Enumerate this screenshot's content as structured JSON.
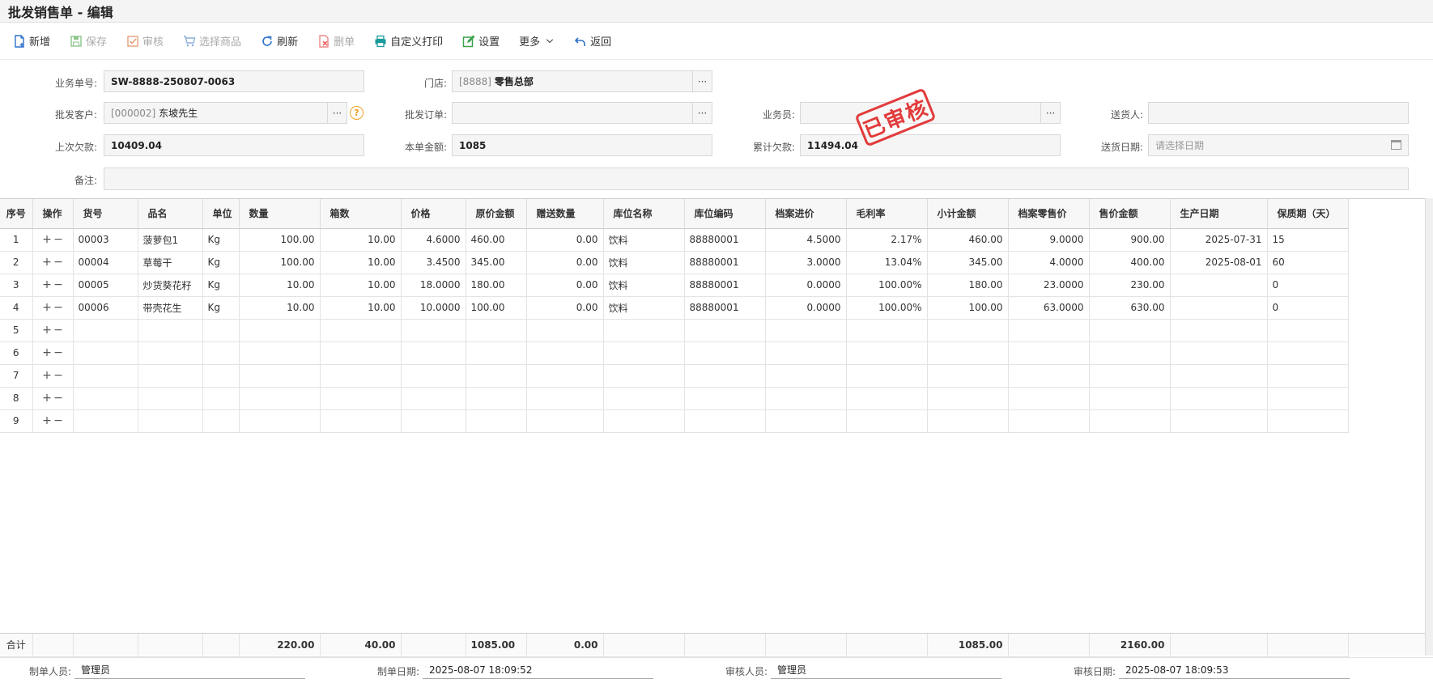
{
  "window": {
    "title": "批发销售单 - 编辑"
  },
  "toolbar": {
    "new": "新增",
    "save": "保存",
    "audit": "审核",
    "select_goods": "选择商品",
    "refresh": "刷新",
    "delete": "删单",
    "custom_print": "自定义打印",
    "settings": "设置",
    "more": "更多",
    "back": "返回"
  },
  "form": {
    "doc_no_label": "业务单号:",
    "doc_no": "SW-8888-250807-0063",
    "store_label": "门店:",
    "store_code": "[8888]",
    "store_name": "零售总部",
    "customer_label": "批发客户:",
    "customer_code": "[000002]",
    "customer_name": "东坡先生",
    "order_label": "批发订单:",
    "order": "",
    "salesman_label": "业务员:",
    "salesman": "",
    "deliverer_label": "送货人:",
    "deliverer": "",
    "last_debt_label": "上次欠款:",
    "last_debt": "10409.04",
    "amount_label": "本单金额:",
    "amount": "1085",
    "total_debt_label": "累计欠款:",
    "total_debt": "11494.04",
    "delivery_date_label": "送货日期:",
    "delivery_date_placeholder": "请选择日期",
    "remark_label": "备注:",
    "remark": "",
    "stamp": "已审核"
  },
  "grid": {
    "columns": [
      "序号",
      "操作",
      "货号",
      "品名",
      "单位",
      "数量",
      "箱数",
      "价格",
      "原价金额",
      "赠送数量",
      "库位名称",
      "库位编码",
      "档案进价",
      "毛利率",
      "小计金额",
      "档案零售价",
      "售价金额",
      "生产日期",
      "保质期（天）"
    ],
    "rows": [
      {
        "no": "1",
        "code": "00003",
        "name": "菠萝包1",
        "unit": "Kg",
        "qty": "100.00",
        "boxes": "10.00",
        "price": "4.6000",
        "orig_amount": "460.00",
        "gift_qty": "0.00",
        "loc_name": "饮料",
        "loc_code": "88880001",
        "cost": "4.5000",
        "margin": "2.17%",
        "subtotal": "460.00",
        "retail": "9.0000",
        "sale_amount": "900.00",
        "prod_date": "2025-07-31",
        "shelf": "15"
      },
      {
        "no": "2",
        "code": "00004",
        "name": "草莓干",
        "unit": "Kg",
        "qty": "100.00",
        "boxes": "10.00",
        "price": "3.4500",
        "orig_amount": "345.00",
        "gift_qty": "0.00",
        "loc_name": "饮料",
        "loc_code": "88880001",
        "cost": "3.0000",
        "margin": "13.04%",
        "subtotal": "345.00",
        "retail": "4.0000",
        "sale_amount": "400.00",
        "prod_date": "2025-08-01",
        "shelf": "60"
      },
      {
        "no": "3",
        "code": "00005",
        "name": "炒货葵花籽",
        "unit": "Kg",
        "qty": "10.00",
        "boxes": "10.00",
        "price": "18.0000",
        "orig_amount": "180.00",
        "gift_qty": "0.00",
        "loc_name": "饮料",
        "loc_code": "88880001",
        "cost": "0.0000",
        "margin": "100.00%",
        "subtotal": "180.00",
        "retail": "23.0000",
        "sale_amount": "230.00",
        "prod_date": "",
        "shelf": "0"
      },
      {
        "no": "4",
        "code": "00006",
        "name": "带壳花生",
        "unit": "Kg",
        "qty": "10.00",
        "boxes": "10.00",
        "price": "10.0000",
        "orig_amount": "100.00",
        "gift_qty": "0.00",
        "loc_name": "饮料",
        "loc_code": "88880001",
        "cost": "0.0000",
        "margin": "100.00%",
        "subtotal": "100.00",
        "retail": "63.0000",
        "sale_amount": "630.00",
        "prod_date": "",
        "shelf": "0"
      },
      {
        "no": "5"
      },
      {
        "no": "6"
      },
      {
        "no": "7"
      },
      {
        "no": "8"
      },
      {
        "no": "9"
      }
    ],
    "op_plus": "+",
    "op_minus": "−",
    "totals": {
      "label": "合计",
      "qty": "220.00",
      "boxes": "40.00",
      "orig_amount": "1085.00",
      "gift_qty": "0.00",
      "subtotal": "1085.00",
      "sale_amount": "2160.00"
    }
  },
  "footer": {
    "creator_label": "制单人员:",
    "creator": "管理员",
    "create_date_label": "制单日期:",
    "create_date": "2025-08-07 18:09:52",
    "auditor_label": "审核人员:",
    "auditor": "管理员",
    "audit_date_label": "审核日期:",
    "audit_date": "2025-08-07 18:09:53"
  },
  "colors": {
    "stamp": "#e23b3b",
    "help_icon": "#f0a020",
    "icon_blue": "#2a6fc9",
    "icon_green": "#3aa24a"
  }
}
